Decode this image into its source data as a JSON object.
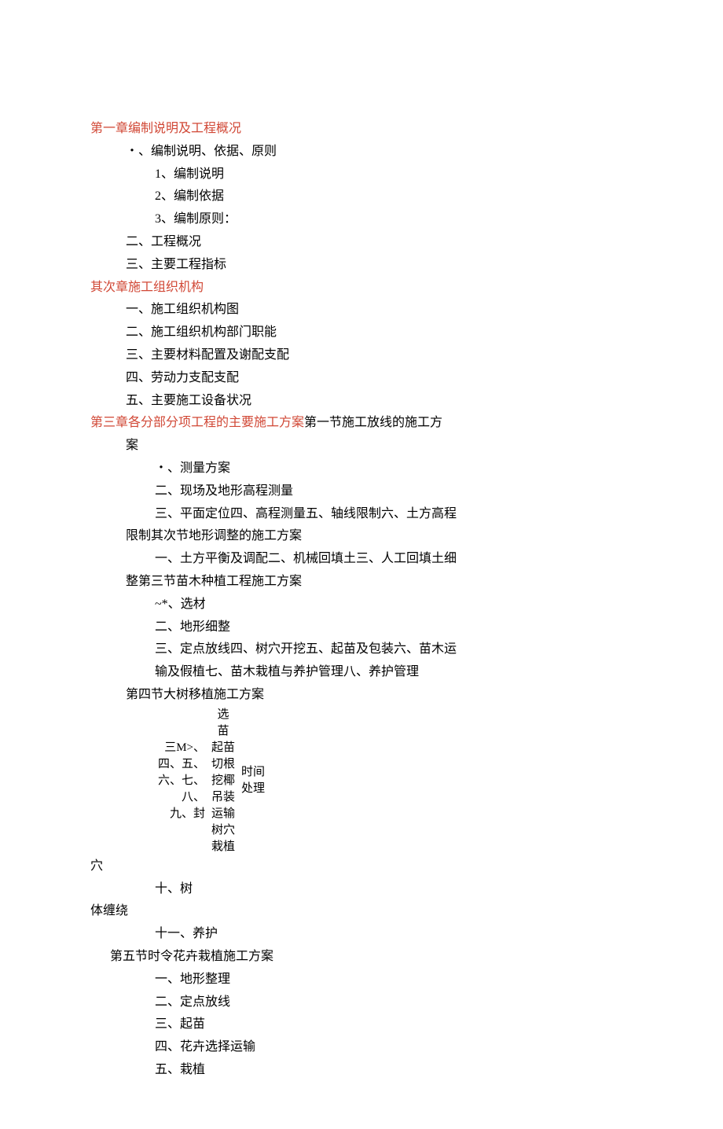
{
  "chapter1": {
    "heading": "第一章编制说明及工程概况",
    "item1": "・、编制说明、依据、原则",
    "sub1": "1、编制说明",
    "sub2": "2、编制依据",
    "sub3": "3、编制原则：",
    "item2": "二、工程概况",
    "item3": "三、主要工程指标"
  },
  "chapter2": {
    "heading": "其次章施工组织机构",
    "item1": "一、施工组织机构图",
    "item2": "二、施工组织机构部门职能",
    "item3": "三、主要材料配置及谢配支配",
    "item4": "四、劳动力支配支配",
    "item5": "五、主要施工设备状况"
  },
  "chapter3": {
    "heading_red": "第三章各分部分项工程的主要施工方案",
    "heading_black": "第一节施工放线的施工方",
    "heading_line2": "案",
    "s1_item1": "・、测量方案",
    "s1_item2": "二、现场及地形高程测量",
    "s1_item3": "三、平面定位四、高程测量五、轴线限制六、土方高程",
    "s1_item3b": "限制其次节地形调整的施工方案",
    "s2_item1": "一、土方平衡及调配二、机械回填土三、人工回填土细",
    "s2_item1b": "整第三节苗木种植工程施工方案",
    "s3_item1": "~*、选材",
    "s3_item2": "二、地形细整",
    "s3_item3": "三、定点放线四、树穴开挖五、起苗及包装六、苗木运",
    "s3_item3b": "输及假植七、苗木栽植与养护管理八、养护管理",
    "section4": "第四节大树移植施工方案",
    "table": {
      "col1": [
        "三M>、",
        "",
        "四、五、",
        "六、七、",
        "八、",
        "九、封"
      ],
      "col2": [
        "选",
        "苗",
        "起苗",
        "切根",
        "挖椰",
        "吊装",
        "运输",
        "树穴",
        "栽植"
      ],
      "col3": [
        "时间",
        "处理"
      ]
    },
    "s4_xue": "穴",
    "s4_item10": "十、树",
    "s4_ti": "体缠绕",
    "s4_item11": "十一、养护",
    "section5": "第五节时令花卉栽植施工方案",
    "s5_item1": "一、地形整理",
    "s5_item2": "二、定点放线",
    "s5_item3": "三、起苗",
    "s5_item4": "四、花卉选择运输",
    "s5_item5": "五、栽植"
  }
}
